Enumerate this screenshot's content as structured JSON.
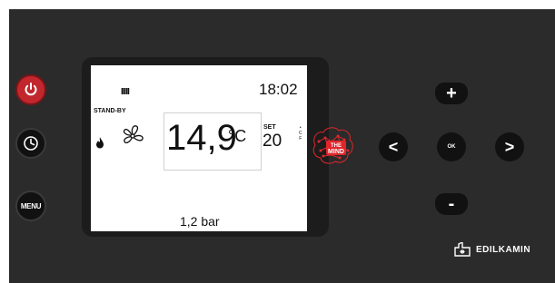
{
  "buttons": {
    "menu_label": "MENU"
  },
  "display": {
    "heater_bars": "IIIII",
    "time": "18:02",
    "status": "STAND-BY",
    "temperature": "14,9",
    "temperature_unit": "°C",
    "set_label": "SET",
    "set_value": "20",
    "unit_c": "C",
    "unit_f": "F",
    "pressure": "1,2 bar"
  },
  "logo": {
    "the_mind_top": "THE",
    "the_mind_bottom": "MIND",
    "brand": "EDILKAMIN"
  },
  "keypad": {
    "plus": "+",
    "minus": "-",
    "left": "<",
    "right": ">",
    "ok": "OK"
  },
  "colors": {
    "power_button": "#c1272d",
    "panel": "#2b2b2b",
    "logo_red": "#e0262b"
  }
}
